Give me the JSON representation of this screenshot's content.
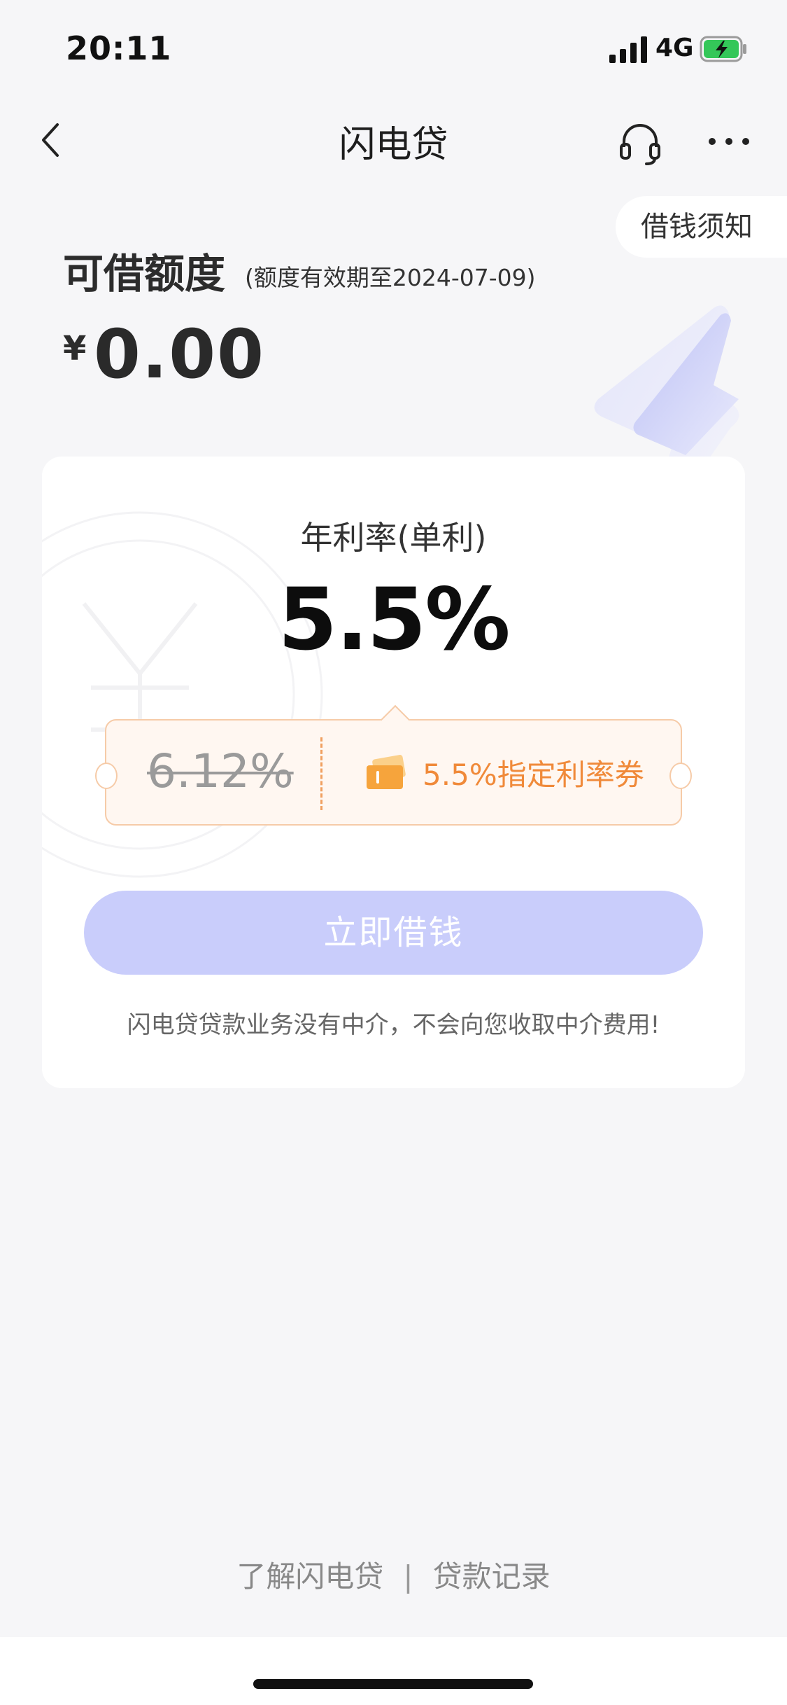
{
  "status_bar": {
    "time": "20:11",
    "network": "4G",
    "battery_color": "#34c759"
  },
  "nav": {
    "title": "闪电贷",
    "back_icon": "chevron-left-icon",
    "support_icon": "headset-icon",
    "more_icon": "more-dots-icon"
  },
  "notice": {
    "label": "借钱须知"
  },
  "credit": {
    "title": "可借额度",
    "validity": "(额度有效期至2024-07-09)",
    "currency": "¥",
    "amount": "0.00"
  },
  "card": {
    "rate_label": "年利率(单利)",
    "rate_value": "5.5%",
    "coupon": {
      "old_rate": "6.12%",
      "text": "5.5%指定利率券",
      "icon": "ticket-icon"
    },
    "button_label": "立即借钱",
    "disclaimer": "闪电贷贷款业务没有中介，不会向您收取中介费用!"
  },
  "footer": {
    "link_about": "了解闪电贷",
    "separator": "|",
    "link_records": "贷款记录"
  },
  "colors": {
    "accent": "#c9cdfb",
    "coupon_orange": "#f08a3a",
    "background": "#f6f6f8"
  }
}
